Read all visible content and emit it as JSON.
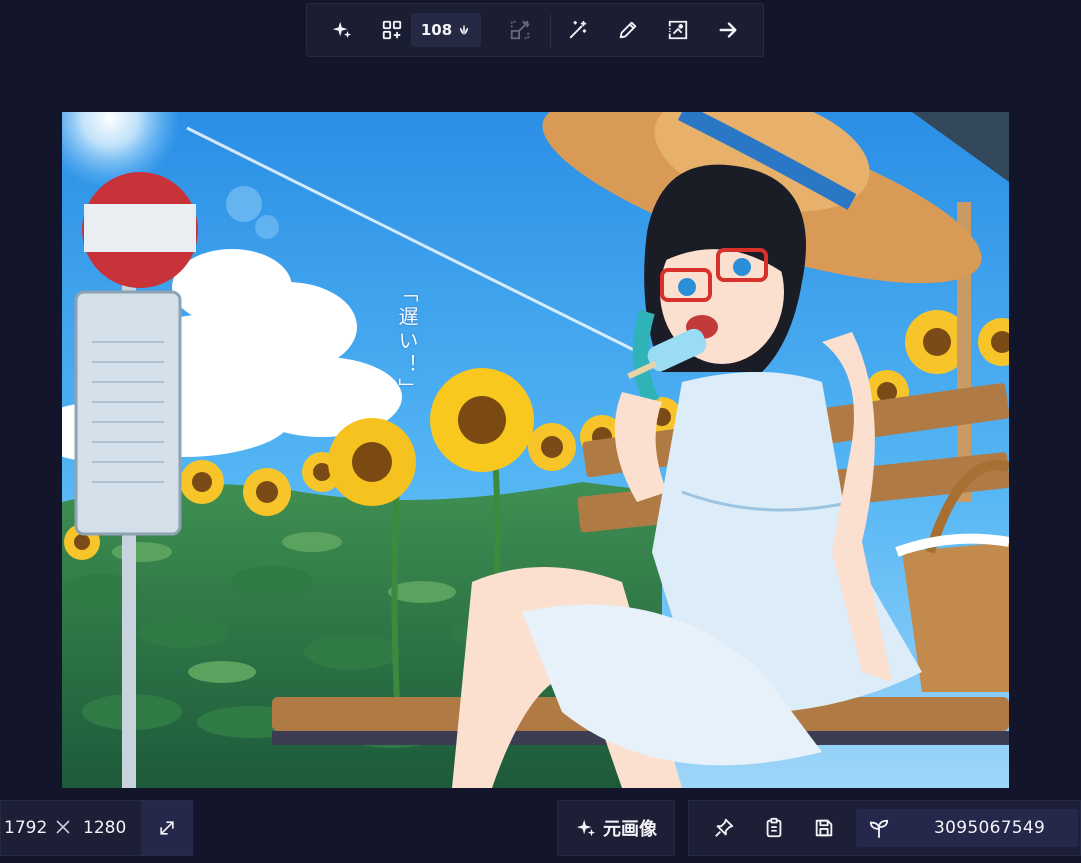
{
  "toolbar": {
    "enhance_icon": "sparkles-icon",
    "variations_icon": "grid-plus-icon",
    "anlas_value": "108",
    "anlas_icon": "anlas-leaf-icon",
    "upscale_icon": "upscale-icon",
    "magic_wand_icon": "wand-icon",
    "pencil_icon": "pencil-icon",
    "inpaint_icon": "inpaint-icon",
    "next_icon": "arrow-right-icon"
  },
  "canvas": {
    "text": "「遅い！」"
  },
  "bottom": {
    "width": "1792",
    "height": "1280",
    "separator_icon": "times-icon",
    "resize_icon": "expand-diagonal-icon",
    "original_image_label": "元画像",
    "original_image_icon": "sparkles-icon",
    "pin_icon": "pin-icon",
    "copy_icon": "clipboard-icon",
    "save_icon": "save-icon",
    "seed_icon": "sprout-icon",
    "seed": "3095067549"
  },
  "colors": {
    "background": "#13152a",
    "panel": "#1d1f36",
    "panel_active": "#25284a",
    "text": "#f3f3f7"
  }
}
